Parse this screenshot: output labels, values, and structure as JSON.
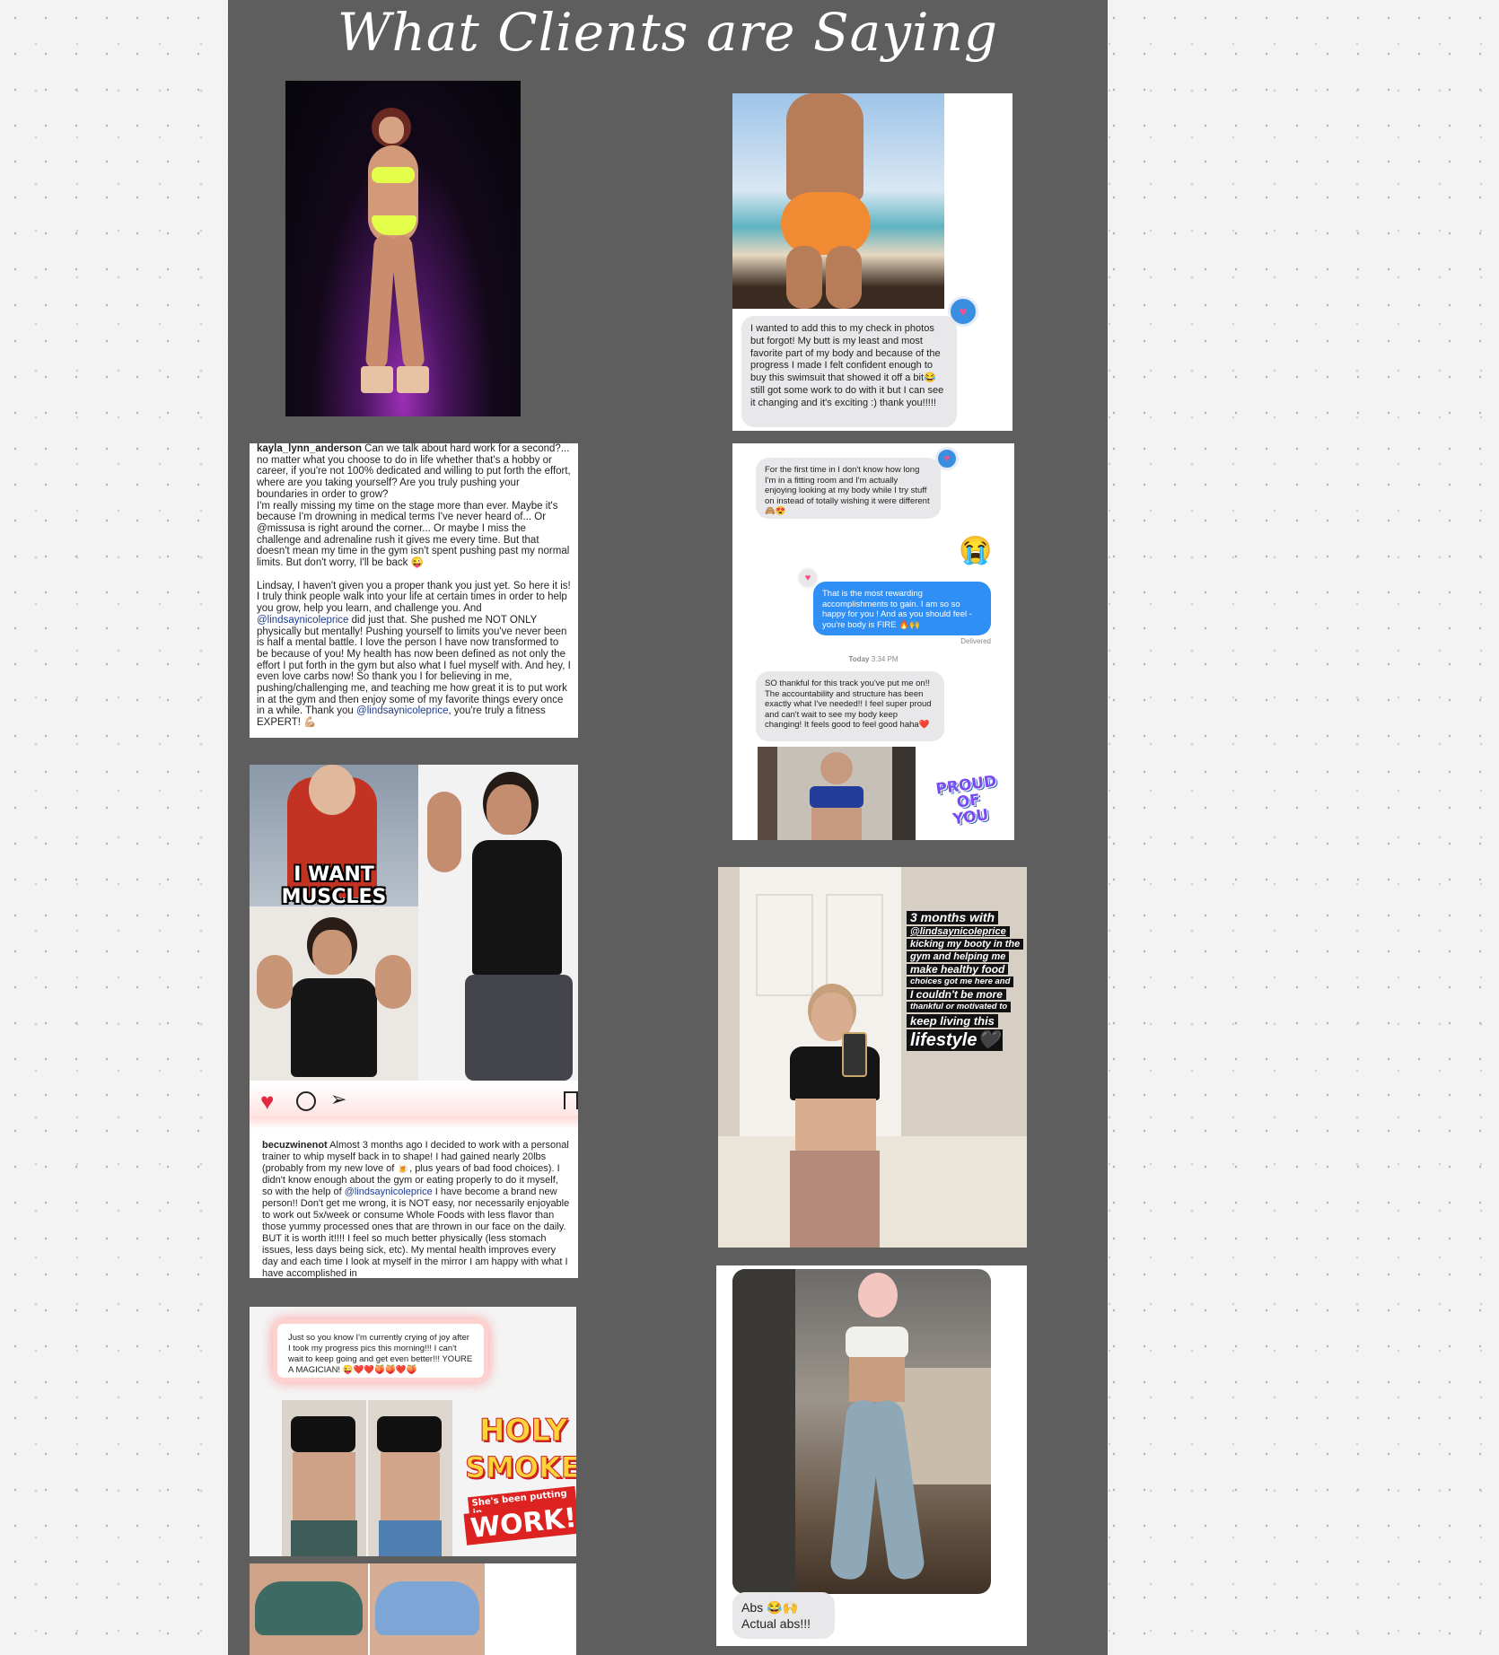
{
  "page": {
    "title": "What Clients are Saying"
  },
  "testimonials": {
    "kayla": {
      "username": "kayla_lynn_anderson",
      "p1": " Can we talk about hard work for a second?... no matter what you choose to do in life whether that's a hobby or career, if you're not 100% dedicated and willing to put forth the effort, where are you taking yourself? Are you truly pushing your boundaries in order to grow?",
      "p2": "I'm really missing my time on the stage more than ever. Maybe it's because I'm drowning in medical terms I've never heard of... Or @missusa is right around the corner... Or maybe I miss the challenge and adrenaline rush it gives me every time. But that doesn't mean my time in the gym isn't spent pushing past my normal limits. But don't worry, I'll be back 😜",
      "p3_a": "Lindsay, I haven't given you a proper thank you just yet. So here it is! I truly think people walk into your life at certain times in order to help you grow, help you learn, and challenge you. And ",
      "mention": "@lindsaynicoleprice",
      "p3_b": " did just that. She pushed me NOT ONLY physically but mentally! Pushing yourself to limits you've never been is half a mental battle. I love the person I have now transformed to be because of you! My health has now been defined as not only the effort I put forth in the gym but also what I fuel myself with. And hey, I even love carbs now! So thank you I for believing in me, pushing/challenging me, and teaching me how great it is to put work in at the gym and then enjoy some of my favorite things every once in a while. Thank you ",
      "p3_c": ", you're truly a fitness EXPERT! 💪🏼"
    },
    "becuz": {
      "meme": "I WANT MUSCLES NOW!",
      "username": "becuzwinenot",
      "text_a": " Almost 3 months ago I decided to work with a personal trainer to whip myself back in to shape! I had gained nearly 20lbs (probably from my new love of 🍺, plus years of bad food choices). I didn't know enough about the gym or eating properly to do it myself, so with the help of ",
      "mention": "@lindsaynicoleprice",
      "text_b": " I have become a brand new person!! Don't get me wrong, it is NOT easy, nor necessarily enjoyable to work out 5x/week or consume Whole Foods with less flavor than those yummy processed ones that are thrown in our face on the daily. BUT it is worth it!!!! I feel so much better physically (less stomach issues, less days being sick, etc). My mental health improves every day and each time I look at myself in the mirror I am happy with what I have accomplished in"
    },
    "holy": {
      "message": "Just so you know I'm currently crying of joy after I took my progress pics this morning!!! I can't wait to keep going and get even better!!! YOURE A MAGICIAN! 😜❤️❤️🍑🍑❤️🍑",
      "sticker1": "HOLY",
      "sticker2": "SMOKES",
      "sticker3": "She's been putting in",
      "sticker4": "WORK!"
    },
    "swimsuit": {
      "message": "I wanted to add this to my check in photos but forgot! My butt is my least and most favorite part of my body and because of the progress I made I felt confident enough to buy this swimsuit that showed it off a bit😂 still got some work to do with it but I can see it changing and it's exciting :) thank you!!!!!"
    },
    "fitting": {
      "msg1": "For the first time in I don't know how long I'm in a fitting room and I'm actually enjoying looking at my body while I try stuff on instead of totally wishing it were different🙈😍",
      "emoji": "😭",
      "reply": "That is the most rewarding accomplishments to gain. I am so so happy for you ! And as you should feel - you're body is FIRE 🔥🙌",
      "delivered": "Delivered",
      "time_day": "Today",
      "time": " 3:34 PM",
      "msg2": "SO thankful for this track you've put me on!! The accountability and structure has been exactly what I've needed!! I feel super proud and can't wait to see my body keep changing! It feels good to feel good haha❤️",
      "sticker": "PROUD OF YOU"
    },
    "months": {
      "lines": [
        "3 months with",
        "@lindsaynicoleprice",
        "kicking my booty in the",
        "gym and helping me",
        "make healthy food",
        "choices got me here and",
        "I couldn't be more",
        "thankful or motivated to",
        "keep living this",
        "lifestyle🖤"
      ]
    },
    "abs": {
      "line1": "Abs 😂🙌",
      "line2": "Actual abs!!!"
    }
  }
}
